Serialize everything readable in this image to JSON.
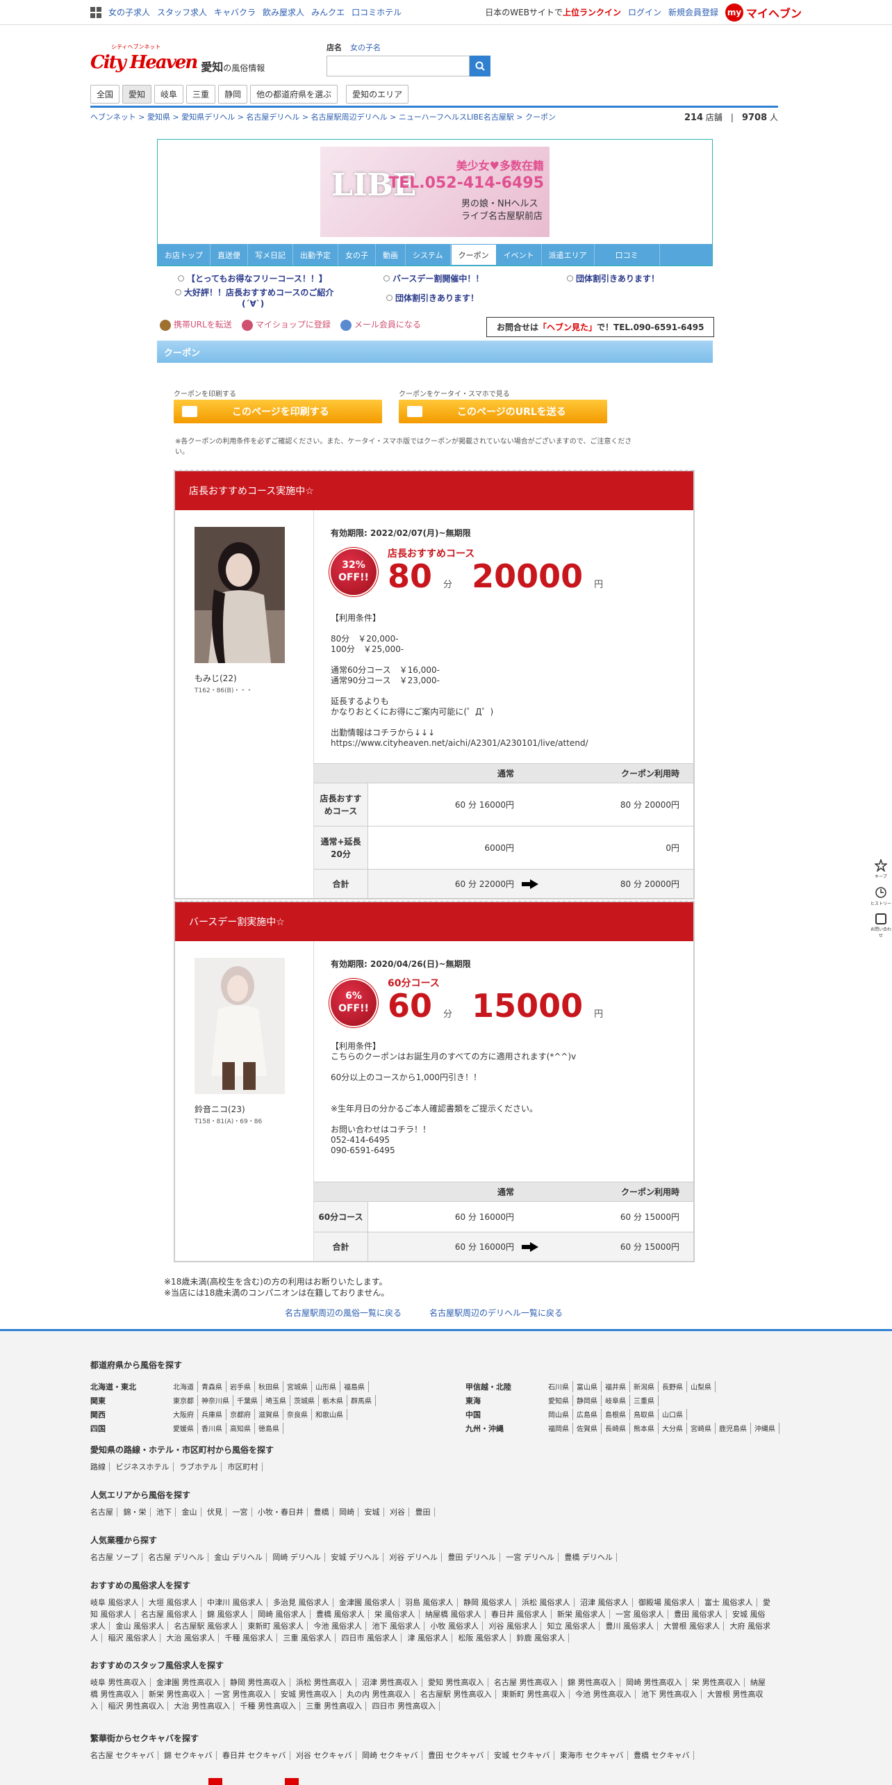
{
  "topbar": {
    "links": [
      "女の子求人",
      "スタッフ求人",
      "キャバクラ",
      "飲み屋求人",
      "みんクエ",
      "口コミホテル"
    ],
    "tagline_pre": "日本のWEBサイトで",
    "tagline_em": "上位ランクイン",
    "login": "ログイン",
    "signup": "新規会員登録",
    "my_badge": "my",
    "my_label": "マイヘブン"
  },
  "header": {
    "logo_text": "City Heaven",
    "logo_sub": "シティヘブンネット",
    "area": "愛知",
    "area_suffix": "の風俗情報",
    "search_tabs": [
      "店名",
      "女の子名"
    ],
    "search_placeholder": ""
  },
  "pref_nav": [
    "全国",
    "愛知",
    "岐阜",
    "三重",
    "静岡",
    "他の都道府県を選ぶ",
    "愛知のエリア"
  ],
  "breadcrumb": "ヘブンネット > 愛知県 > 愛知県デリヘル > 名古屋デリヘル > 名古屋駅周辺デリヘル > ニューハーフヘルスLIBE名古屋駅 > クーポン",
  "stats": {
    "shops": "214",
    "shops_unit": "店舗",
    "people": "9708",
    "people_unit": "人"
  },
  "banner": {
    "name": "LIBE",
    "tagline": "美少女♥多数在籍",
    "tel": "TEL.052-414-6495",
    "line1": "男の娘・NHヘルス",
    "line2": "ライブ名古屋駅前店"
  },
  "shop_nav": [
    "お店トップ",
    "直送便",
    "写メ日記",
    "出勤予定",
    "女の子",
    "動画",
    "システム",
    "クーポン",
    "イベント",
    "派遣エリア",
    "口コミ"
  ],
  "notices": [
    "【とってもお得なフリーコース！！】",
    "バースデー割開催中！！",
    "団体割引きあります！",
    "大好評！！店長おすすめコースのご紹介",
    "(´∀`)",
    "団体割引きあります！"
  ],
  "tools": {
    "mobile": "携帯URLを転送",
    "myshop": "マイショップに登録",
    "mail": "メール会員になる"
  },
  "inquiry": {
    "pre": "お問合せは",
    "em": "「ヘブン見た」",
    "post": "で！TEL.090-6591-6495"
  },
  "coupon_header": "クーポン",
  "print": {
    "cap1": "クーポンを印刷する",
    "btn1": "このページを印刷する",
    "cap2": "クーポンをケータイ・スマホで見る",
    "btn2": "このページのURLを送る"
  },
  "note": "※各クーポンの利用条件を必ずご確認ください。また、ケータイ・スマホ版ではクーポンが掲載されていない場合がございますので、ご注意ください。",
  "coupons": [
    {
      "title": "店長おすすめコース実施中☆",
      "girl_name": "もみじ(22)",
      "girl_size": "T162・86(B)・・・",
      "period": "有効期限: 2022/02/07(月)~無期限",
      "off_pct": "32%",
      "off": "OFF!!",
      "course": "店長おすすめコース",
      "minutes": "80",
      "min_unit": "分",
      "price": "20000",
      "yen": "円",
      "conditions": "【利用条件】\n\n80分　￥20,000-\n100分　￥25,000-\n\n通常60分コース　￥16,000-\n通常90分コース　￥23,000-\n\n延長するよりも\nかなりおとくにお得にご案内可能に(゜Д゜)\n\n出勤情報はコチラから↓↓↓\nhttps://www.cityheaven.net/aichi/A2301/A230101/live/attend/",
      "table_head": [
        "通常",
        "クーポン利用時"
      ],
      "rows": [
        {
          "label": "店長おすすめコース",
          "normal": "60 分 16000円",
          "coupon": "80 分 20000円"
        },
        {
          "label": "通常+延長20分",
          "normal": "6000円",
          "coupon": "0円"
        }
      ],
      "total": {
        "label": "合計",
        "normal": "60 分 22000円",
        "coupon": "80 分 20000円"
      }
    },
    {
      "title": "バースデー割実施中☆",
      "girl_name": "鈴音ニコ(23)",
      "girl_size": "T158・81(A)・69・86",
      "period": "有効期限: 2020/04/26(日)~無期限",
      "off_pct": "6%",
      "off": "OFF!!",
      "course": "60分コース",
      "minutes": "60",
      "min_unit": "分",
      "price": "15000",
      "yen": "円",
      "conditions": "【利用条件】\nこちらのクーポンはお誕生月のすべての方に適用されます(*^^)v\n\n60分以上のコースから1,000円引き！！\n\n\n※生年月日の分かるご本人確認書類をご提示ください。\n\nお問い合わせはコチラ！！\n052-414-6495\n090-6591-6495",
      "table_head": [
        "通常",
        "クーポン利用時"
      ],
      "rows": [
        {
          "label": "60分コース",
          "normal": "60 分 16000円",
          "coupon": "60 分 15000円"
        }
      ],
      "total": {
        "label": "合計",
        "normal": "60 分 16000円",
        "coupon": "60 分 15000円"
      }
    }
  ],
  "foot_notes": [
    "※18歳未満(高校生を含む)の方の利用はお断りいたします。",
    "※当店には18歳未満のコンパニオンは在籍しておりません。"
  ],
  "back_links": [
    "名古屋駅周辺の風俗一覧に戻る",
    "名古屋駅周辺のデリヘル一覧に戻る"
  ],
  "footer": {
    "pref_title": "都道府県から風俗を探す",
    "regions": [
      {
        "name": "北海道・東北",
        "items": [
          "北海道",
          "青森県",
          "岩手県",
          "秋田県",
          "宮城県",
          "山形県",
          "福島県"
        ]
      },
      {
        "name": "関東",
        "items": [
          "東京都",
          "神奈川県",
          "千葉県",
          "埼玉県",
          "茨城県",
          "栃木県",
          "群馬県"
        ]
      },
      {
        "name": "関西",
        "items": [
          "大阪府",
          "兵庫県",
          "京都府",
          "滋賀県",
          "奈良県",
          "和歌山県"
        ]
      },
      {
        "name": "四国",
        "items": [
          "愛媛県",
          "香川県",
          "高知県",
          "徳島県"
        ]
      },
      {
        "name": "甲信越・北陸",
        "items": [
          "石川県",
          "富山県",
          "福井県",
          "新潟県",
          "長野県",
          "山梨県"
        ]
      },
      {
        "name": "東海",
        "items": [
          "愛知県",
          "静岡県",
          "岐阜県",
          "三重県"
        ]
      },
      {
        "name": "中国",
        "items": [
          "岡山県",
          "広島県",
          "島根県",
          "鳥取県",
          "山口県"
        ]
      },
      {
        "name": "九州・沖縄",
        "items": [
          "福岡県",
          "佐賀県",
          "長崎県",
          "熊本県",
          "大分県",
          "宮崎県",
          "鹿児島県",
          "沖縄県"
        ]
      }
    ],
    "sections": [
      {
        "title": "愛知県の路線・ホテル・市区町村から風俗を探す",
        "items": [
          "路線",
          "ビジネスホテル",
          "ラブホテル",
          "市区町村"
        ]
      },
      {
        "title": "人気エリアから風俗を探す",
        "items": [
          "名古屋",
          "錦・栄",
          "池下",
          "金山",
          "伏見",
          "一宮",
          "小牧・春日井",
          "豊橋",
          "岡崎",
          "安城",
          "刈谷",
          "豊田"
        ]
      },
      {
        "title": "人気業種から探す",
        "items": [
          "名古屋 ソープ",
          "名古屋 デリヘル",
          "金山 デリヘル",
          "岡崎 デリヘル",
          "安城 デリヘル",
          "刈谷 デリヘル",
          "豊田 デリヘル",
          "一宮 デリヘル",
          "豊橋 デリヘル"
        ]
      },
      {
        "title": "おすすめの風俗求人を探す",
        "items": [
          "岐阜 風俗求人",
          "大垣 風俗求人",
          "中津川 風俗求人",
          "多治見 風俗求人",
          "金津園 風俗求人",
          "羽島 風俗求人",
          "静岡 風俗求人",
          "浜松 風俗求人",
          "沼津 風俗求人",
          "御殿場 風俗求人",
          "富士 風俗求人",
          "愛知 風俗求人",
          "名古屋 風俗求人",
          "錦 風俗求人",
          "岡崎 風俗求人",
          "豊橋 風俗求人",
          "栄 風俗求人",
          "納屋橋 風俗求人",
          "春日井 風俗求人",
          "新栄 風俗求人",
          "一宮 風俗求人",
          "豊田 風俗求人",
          "安城 風俗求人",
          "金山 風俗求人",
          "名古屋駅 風俗求人",
          "東新町 風俗求人",
          "今池 風俗求人",
          "池下 風俗求人",
          "小牧 風俗求人",
          "刈谷 風俗求人",
          "知立 風俗求人",
          "豊川 風俗求人",
          "大曽根 風俗求人",
          "大府 風俗求人",
          "稲沢 風俗求人",
          "大治 風俗求人",
          "千種 風俗求人",
          "三重 風俗求人",
          "四日市 風俗求人",
          "津 風俗求人",
          "松阪 風俗求人",
          "鈴鹿 風俗求人"
        ]
      },
      {
        "title": "おすすめのスタッフ風俗求人を探す",
        "items": [
          "岐阜 男性高収入",
          "金津園 男性高収入",
          "静岡 男性高収入",
          "浜松 男性高収入",
          "沼津 男性高収入",
          "愛知 男性高収入",
          "名古屋 男性高収入",
          "錦 男性高収入",
          "岡崎 男性高収入",
          "栄 男性高収入",
          "納屋橋 男性高収入",
          "新栄 男性高収入",
          "一宮 男性高収入",
          "安城 男性高収入",
          "丸の内 男性高収入",
          "名古屋駅 男性高収入",
          "東新町 男性高収入",
          "今池 男性高収入",
          "池下 男性高収入",
          "大曽根 男性高収入",
          "稲沢 男性高収入",
          "大治 男性高収入",
          "千種 男性高収入",
          "三重 男性高収入",
          "四日市 男性高収入"
        ]
      },
      {
        "title": "繁華街からセクキャバを探す",
        "items": [
          "名古屋 セクキャバ",
          "錦 セクキャバ",
          "春日井 セクキャバ",
          "刈谷 セクキャバ",
          "岡崎 セクキャバ",
          "豊田 セクキャバ",
          "安城 セクキャバ",
          "東海市 セクキャバ",
          "豊橋 セクキャバ"
        ]
      }
    ]
  },
  "side": [
    "キープ",
    "ヒストリー",
    "お問い合わせ"
  ]
}
